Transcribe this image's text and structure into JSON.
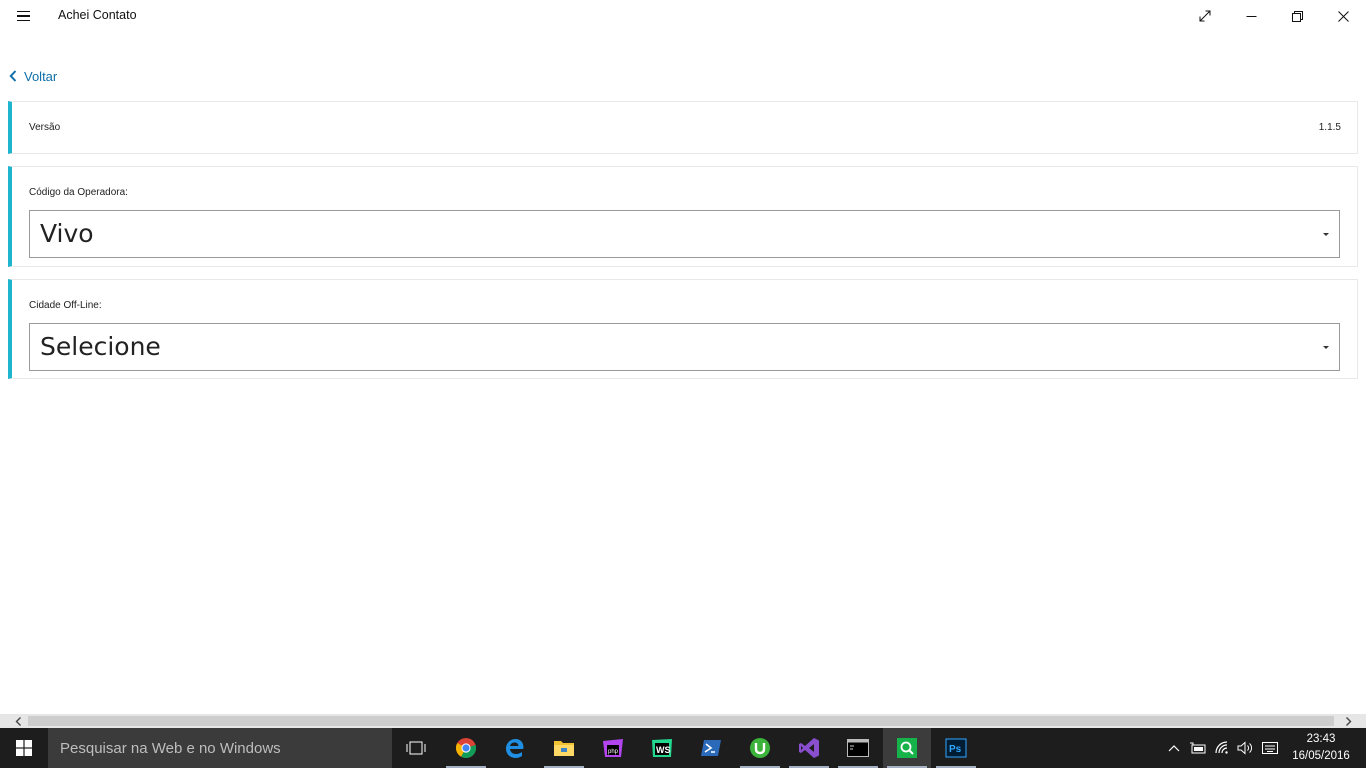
{
  "window": {
    "title": "Achei Contato"
  },
  "nav": {
    "back_label": "Voltar"
  },
  "settings": {
    "version": {
      "label": "Versão",
      "value": "1.1.5"
    },
    "operator": {
      "label": "Código da Operadora:",
      "selected": "Vivo"
    },
    "city": {
      "label": "Cidade Off-Line:",
      "selected": "Selecione"
    }
  },
  "taskbar": {
    "search_placeholder": "Pesquisar na Web e no Windows",
    "apps": [
      "task-view",
      "chrome",
      "edge",
      "file-explorer",
      "phpstorm",
      "webstorm",
      "powershell",
      "utorrent",
      "visual-studio",
      "command-prompt",
      "achei-contato",
      "photoshop"
    ],
    "clock_time": "23:43",
    "clock_date": "16/05/2016"
  },
  "colors": {
    "accent": "#1fb5cf",
    "link": "#0f6fa8",
    "taskbar": "#1d1d1d"
  }
}
